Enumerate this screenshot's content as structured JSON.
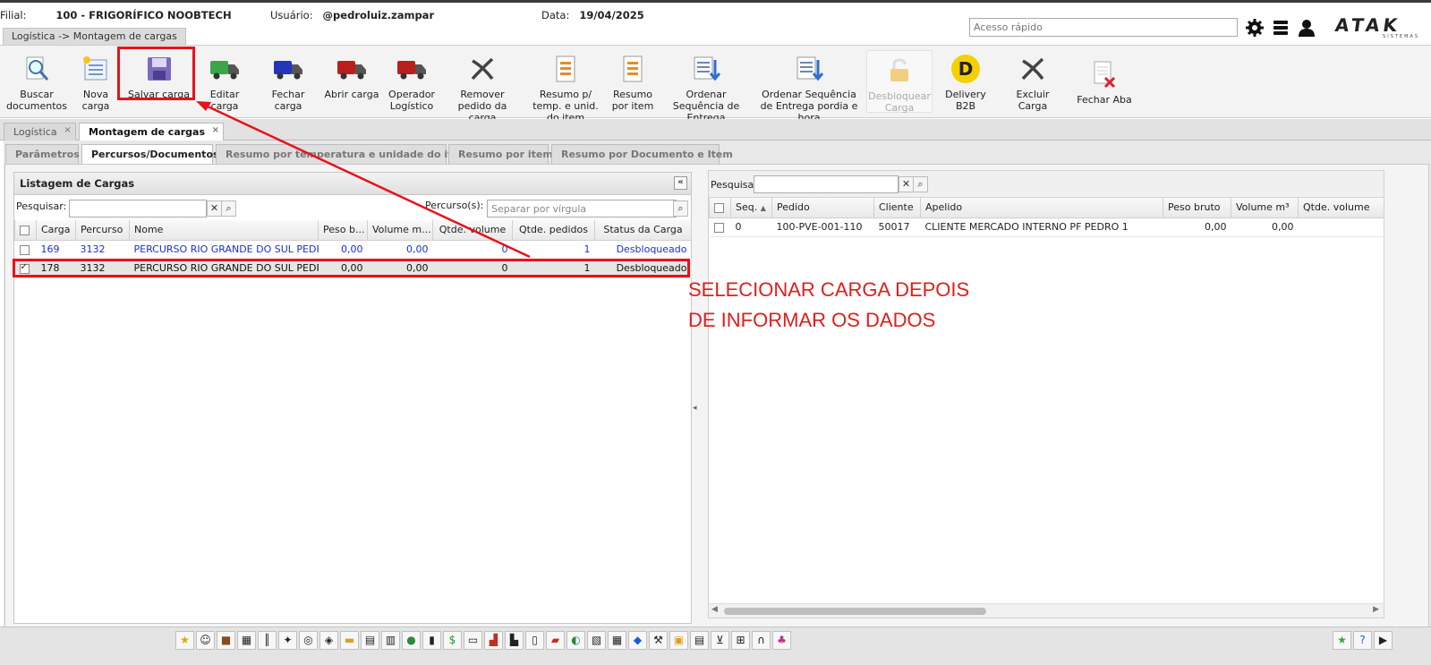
{
  "header": {
    "filial_label": "Filial:",
    "filial_value": "100 - FRIGORÍFICO NOOBTECH",
    "usuario_label": "Usuário:",
    "usuario_value": "@pedroluiz.zampar",
    "data_label": "Data:",
    "data_value": "19/04/2025",
    "quick_access_placeholder": "Acesso rápido",
    "logo_text": "ATAK",
    "logo_sub": "SISTEMAS"
  },
  "breadcrumb": "Logística -> Montagem de cargas",
  "toolbar": [
    {
      "name": "buscar-documentos-button",
      "label": "Buscar documentos",
      "icon": "magnifier-document-icon"
    },
    {
      "name": "nova-carga-button",
      "label": "Nova carga",
      "icon": "new-list-icon"
    },
    {
      "name": "salvar-carga-button",
      "label": "Salvar carga",
      "icon": "floppy-disk-icon"
    },
    {
      "name": "editar-carga-button",
      "label": "Editar carga",
      "icon": "green-truck-icon"
    },
    {
      "name": "fechar-carga-button",
      "label": "Fechar carga",
      "icon": "blue-truck-icon"
    },
    {
      "name": "abrir-carga-button",
      "label": "Abrir carga",
      "icon": "red-truck-icon"
    },
    {
      "name": "operador-logistico-button",
      "label": "Operador Logístico",
      "icon": "red-truck-icon"
    },
    {
      "name": "remover-pedido-button",
      "label": "Remover pedido da carga",
      "icon": "x-cross-icon"
    },
    {
      "name": "resumo-temp-button",
      "label": "Resumo p/ temp. e unid. do item",
      "icon": "report-icon"
    },
    {
      "name": "resumo-item-button",
      "label": "Resumo por item",
      "icon": "report-icon"
    },
    {
      "name": "ordenar-entrega-button",
      "label": "Ordenar Sequência de Entrega",
      "icon": "sort-list-icon"
    },
    {
      "name": "ordenar-data-hora-button",
      "label": "Ordenar Sequência de Entrega pordia e hora",
      "icon": "sort-list-icon"
    },
    {
      "name": "desbloquear-carga-button",
      "label": "Desbloquear Carga",
      "icon": "padlock-icon"
    },
    {
      "name": "delivery-b2b-button",
      "label": "Delivery B2B",
      "icon": "delivery-logo-icon"
    },
    {
      "name": "excluir-carga-button",
      "label": "Excluir Carga",
      "icon": "x-cross-icon"
    },
    {
      "name": "fechar-aba-button",
      "label": "Fechar Aba",
      "icon": "close-document-icon"
    }
  ],
  "page_tabs": [
    {
      "label": "Logística",
      "close": "×"
    },
    {
      "label": "Montagem de cargas",
      "close": "×"
    }
  ],
  "sub_tabs": [
    "Parâmetros",
    "Percursos/Documentos",
    "Resumo por temperatura e unidade do item",
    "Resumo por item",
    "Resumo por Documento e Item"
  ],
  "left_panel": {
    "title": "Listagem de Cargas",
    "collapse": "«",
    "search_label": "Pesquisar:",
    "percursos_label": "Percurso(s):",
    "percursos_placeholder": "Separar por vírgula",
    "columns": [
      "Carga",
      "Percurso",
      "Nome",
      "Peso b...",
      "Volume m...",
      "Qtde. volume",
      "Qtde. pedidos",
      "Status da Carga"
    ],
    "rows": [
      {
        "carga": "169",
        "percurso": "3132",
        "nome": "PERCURSO RIO GRANDE DO SUL PEDRO",
        "peso": "0,00",
        "volume": "0,00",
        "qtde_volume": "0",
        "qtde_pedidos": "1",
        "status": "Desbloqueado"
      },
      {
        "carga": "178",
        "percurso": "3132",
        "nome": "PERCURSO RIO GRANDE DO SUL PEDRO",
        "peso": "0,00",
        "volume": "0,00",
        "qtde_volume": "0",
        "qtde_pedidos": "1",
        "status": "Desbloqueado"
      }
    ]
  },
  "right_panel": {
    "search_label": "Pesquisar",
    "columns": [
      "Seq.",
      "Pedido",
      "Cliente",
      "Apelido",
      "Peso bruto",
      "Volume m³",
      "Qtde. volume"
    ],
    "rows": [
      {
        "seq": "0",
        "pedido": "100-PVE-001-110",
        "cliente": "50017",
        "apelido": "CLIENTE MERCADO INTERNO PF PEDRO 1",
        "peso": "0,00",
        "volume": "0,00",
        "qtde": ""
      }
    ]
  },
  "annotation": {
    "line1": "SELECIONAR CARGA DEPOIS",
    "line2": "DE INFORMAR OS DADOS",
    "color": "#e21d1d"
  },
  "colors": {
    "annotation_red": "#e8121a",
    "link_blue": "#1b2fd6"
  }
}
